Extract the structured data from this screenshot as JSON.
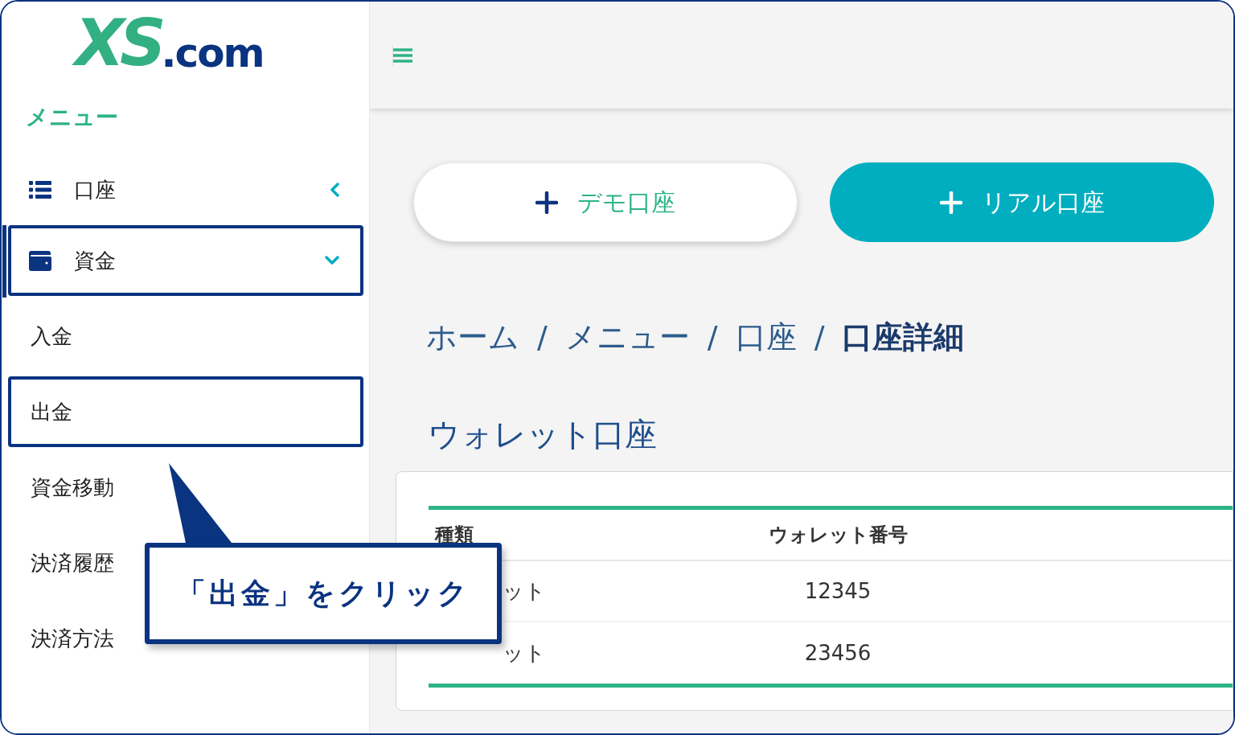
{
  "logo": {
    "mark": "XS",
    "suffix": ".com"
  },
  "sidebar": {
    "heading": "メニュー",
    "items": [
      {
        "label": "口座",
        "expanded": false,
        "highlighted": false
      },
      {
        "label": "資金",
        "expanded": true,
        "highlighted": true,
        "children": [
          {
            "label": "入金",
            "highlighted": false
          },
          {
            "label": "出金",
            "highlighted": true
          },
          {
            "label": "資金移動",
            "highlighted": false
          },
          {
            "label": "決済履歴",
            "highlighted": false
          },
          {
            "label": "決済方法",
            "highlighted": false
          }
        ]
      }
    ]
  },
  "buttons": [
    {
      "label": "デモ口座",
      "kind": "outline"
    },
    {
      "label": "リアル口座",
      "kind": "filled"
    }
  ],
  "breadcrumb": [
    {
      "label": "ホーム",
      "current": false
    },
    {
      "label": "メニュー",
      "current": false
    },
    {
      "label": "口座",
      "current": false
    },
    {
      "label": "口座詳細",
      "current": true
    }
  ],
  "breadcrumb_separator": "/",
  "section_title": "ウォレット口座",
  "table": {
    "columns": [
      "種類",
      "ウォレット番号"
    ],
    "rows": [
      [
        "ット",
        "12345"
      ],
      [
        "ット",
        "23456"
      ]
    ]
  },
  "callout": {
    "text": "「出金」をクリック"
  }
}
